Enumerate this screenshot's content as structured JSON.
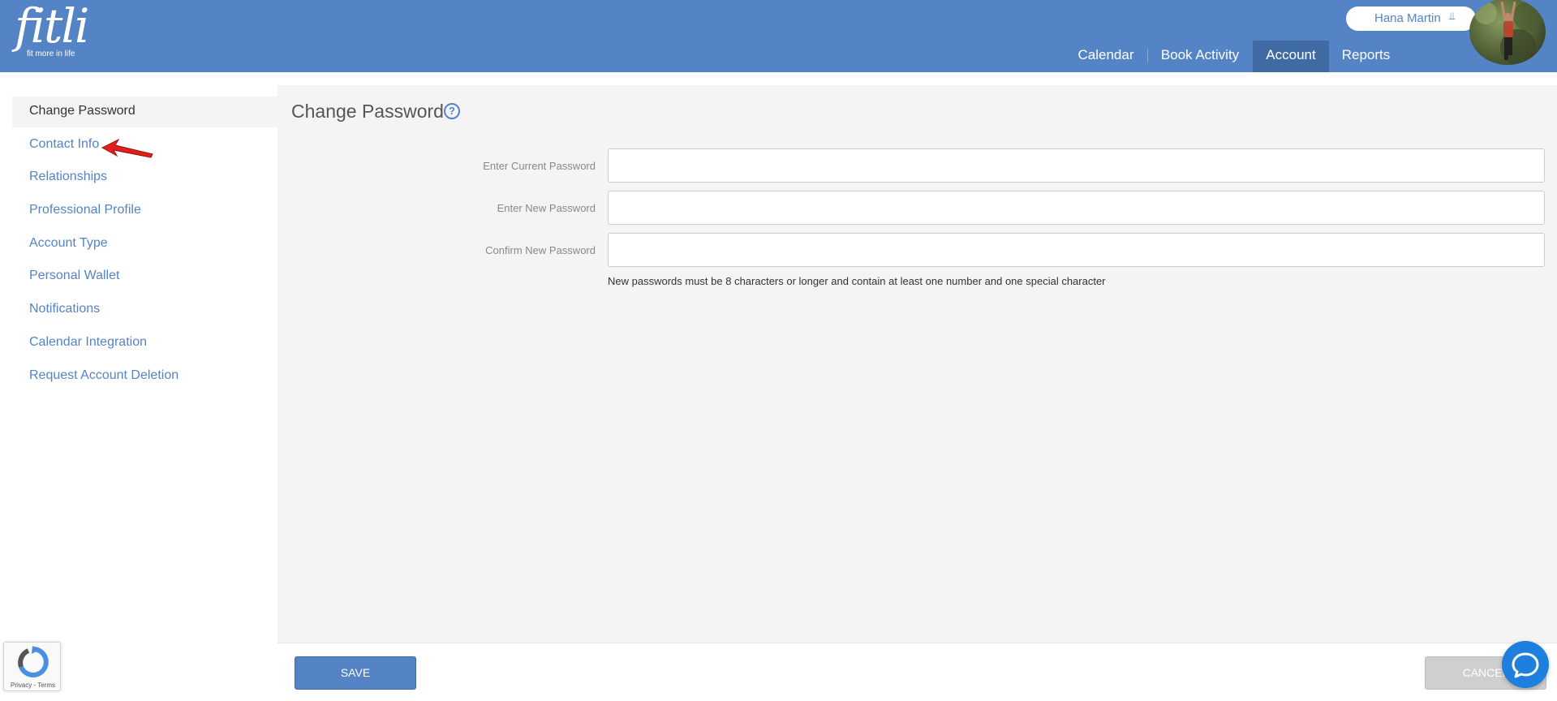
{
  "header": {
    "logo_word": "fitli",
    "logo_tagline": "fit more in life",
    "user_name": "Hana Martin",
    "nav": [
      {
        "label": "Calendar"
      },
      {
        "label": "Book Activity"
      },
      {
        "label": "Account",
        "active": true
      },
      {
        "label": "Reports"
      }
    ]
  },
  "sidebar": {
    "items": [
      {
        "label": "Change Password",
        "active": true
      },
      {
        "label": "Contact Info"
      },
      {
        "label": "Relationships"
      },
      {
        "label": "Professional Profile"
      },
      {
        "label": "Account Type"
      },
      {
        "label": "Personal Wallet"
      },
      {
        "label": "Notifications"
      },
      {
        "label": "Calendar Integration"
      },
      {
        "label": "Request Account Deletion"
      }
    ]
  },
  "main": {
    "title": "Change Password",
    "help_icon": "question-circle-icon",
    "fields": [
      {
        "label": "Enter Current Password",
        "value": "",
        "placeholder": ""
      },
      {
        "label": "Enter New Password",
        "value": "",
        "placeholder": ""
      },
      {
        "label": "Confirm New Password",
        "value": "",
        "placeholder": ""
      }
    ],
    "hint": "New passwords must be 8 characters or longer and contain at least one number and one special character"
  },
  "footer": {
    "save_label": "SAVE",
    "cancel_label": "CANCEL"
  },
  "recaptcha": {
    "text": "Privacy - Terms"
  },
  "colors": {
    "brand_blue": "#5484c6",
    "active_nav": "#3f6aa3",
    "panel_bg": "#f4f4f4",
    "chat_blue": "#1f7fdc"
  }
}
